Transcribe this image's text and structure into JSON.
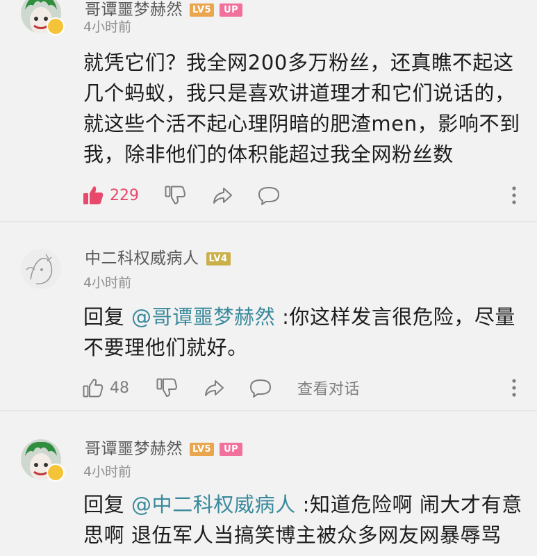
{
  "accent": {
    "like_active": "#e8496a",
    "mention": "#3a8a9c",
    "up_badge": "#f1719c",
    "lv_badge": "#e9a64f"
  },
  "comments": [
    {
      "username": "哥谭噩梦赫然",
      "level": "LV5",
      "up": "UP",
      "time": "4小时前",
      "text": "就凭它们？我全网200多万粉丝，还真瞧不起这几个蚂蚁，我只是喜欢讲道理才和它们说话的，就这些个活不起心理阴暗的肥渣men，影响不到我，除非他们的体积能超过我全网粉丝数",
      "likes": "229",
      "liked": true,
      "icons": [
        "thumbs-up-icon",
        "thumbs-down-icon",
        "share-icon",
        "reply-icon",
        "more-icon"
      ]
    },
    {
      "username": "中二科权威病人",
      "level": "LV4",
      "time": "4小时前",
      "reply_prefix": "回复",
      "mention": "@哥谭噩梦赫然",
      "text": ":你这样发言很危险，尽量不要理他们就好。",
      "likes": "48",
      "liked": false,
      "view_conversation": "查看对话",
      "icons": [
        "thumbs-up-icon",
        "thumbs-down-icon",
        "share-icon",
        "reply-icon",
        "more-icon"
      ]
    },
    {
      "username": "哥谭噩梦赫然",
      "level": "LV5",
      "up": "UP",
      "time": "4小时前",
      "reply_prefix": "回复",
      "mention": "@中二科权威病人",
      "text": ":知道危险啊  闹大才有意思啊  退伍军人当搞笑博主被众多网友网暴辱骂"
    }
  ]
}
